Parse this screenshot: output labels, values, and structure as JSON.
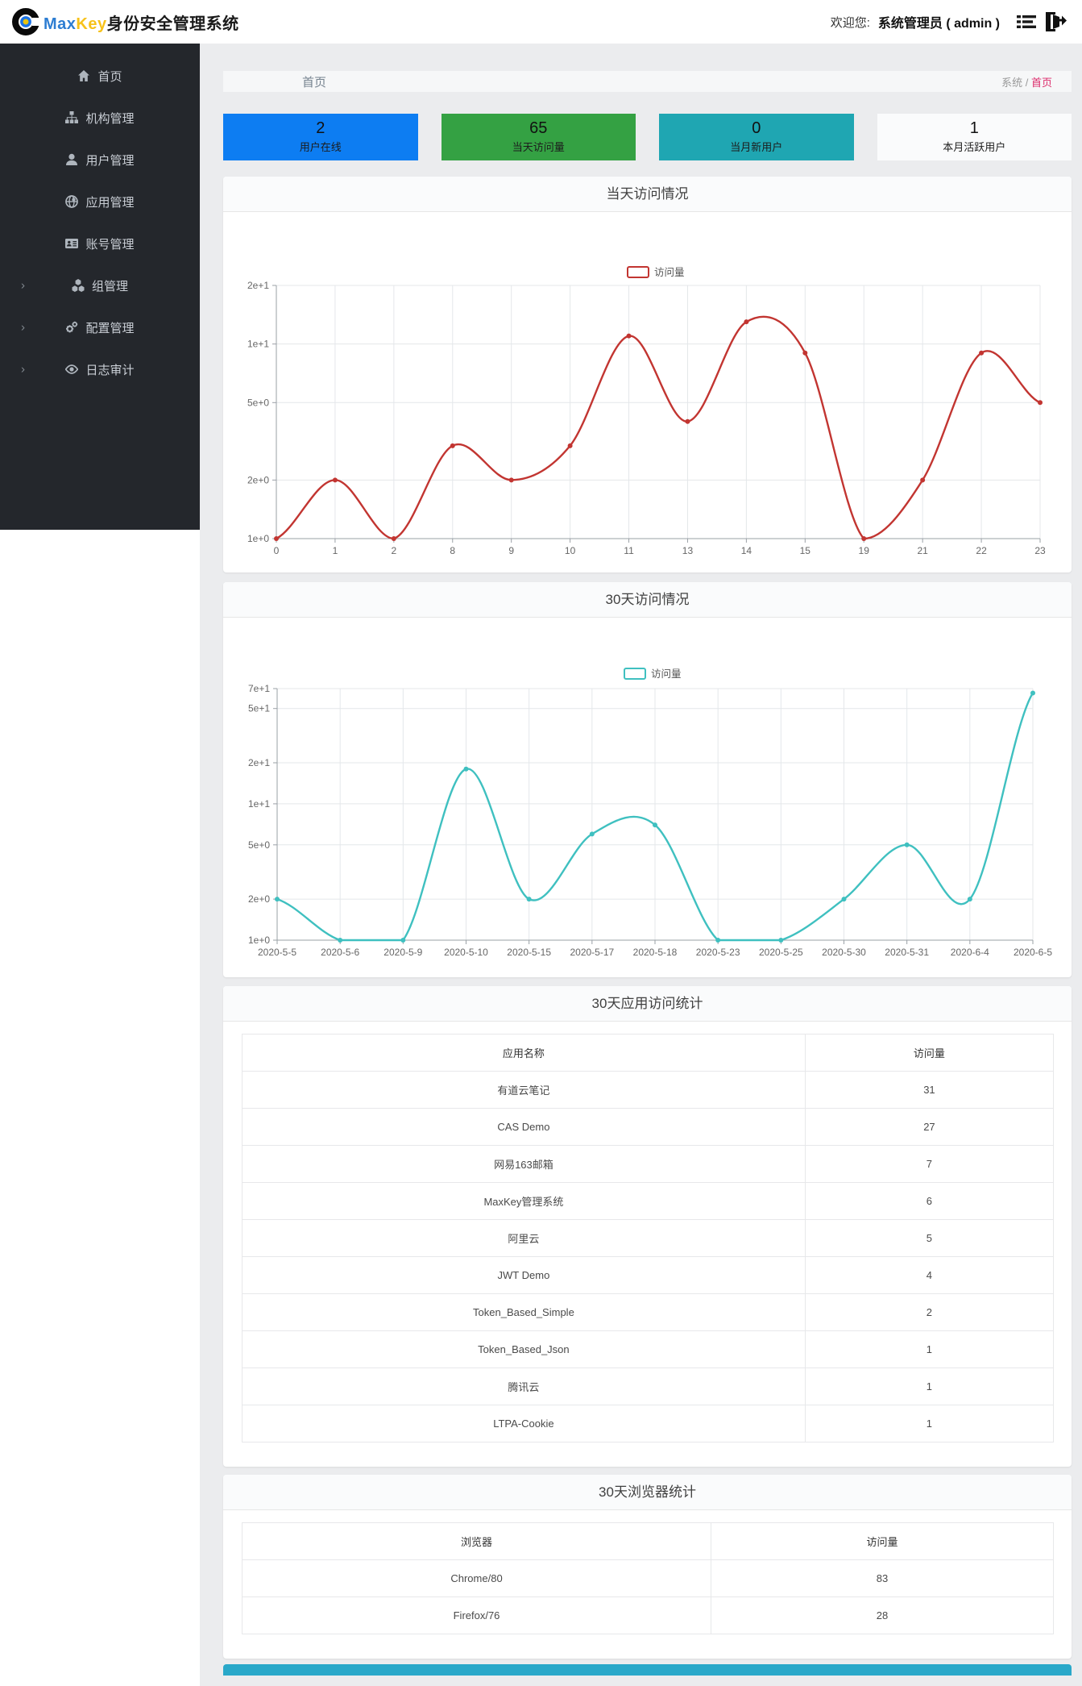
{
  "header": {
    "brand_max": "Max",
    "brand_key": "Key",
    "brand_suffix": "身份安全管理系统",
    "welcome_label": "欢迎您:",
    "admin_label": "系统管理员 ( admin )"
  },
  "sidebar": {
    "items": [
      {
        "label": "首页",
        "icon": "home-icon",
        "expandable": false
      },
      {
        "label": "机构管理",
        "icon": "org-icon",
        "expandable": false
      },
      {
        "label": "用户管理",
        "icon": "user-icon",
        "expandable": false
      },
      {
        "label": "应用管理",
        "icon": "app-icon",
        "expandable": false
      },
      {
        "label": "账号管理",
        "icon": "account-icon",
        "expandable": false
      },
      {
        "label": "组管理",
        "icon": "group-icon",
        "expandable": true
      },
      {
        "label": "配置管理",
        "icon": "config-icon",
        "expandable": true
      },
      {
        "label": "日志审计",
        "icon": "audit-icon",
        "expandable": true
      }
    ]
  },
  "breadcrumb": {
    "title": "首页",
    "crumb_root": "系统",
    "crumb_sep": " / ",
    "crumb_current": "首页"
  },
  "stat_cards": [
    {
      "value": "2",
      "label": "用户在线",
      "color": "#0d7df2"
    },
    {
      "value": "65",
      "label": "当天访问量",
      "color": "#34a143"
    },
    {
      "value": "0",
      "label": "当月新用户",
      "color": "#1fa6b2"
    },
    {
      "value": "1",
      "label": "本月活跃用户",
      "color": "#fafbfc"
    }
  ],
  "chart_data": [
    {
      "type": "line",
      "title": "当天访问情况",
      "legend": "访问量",
      "color": "#c23531",
      "smooth": true,
      "grid": true,
      "legend_position": "top-center",
      "y_scale": "log",
      "ylim": [
        1,
        20
      ],
      "y_ticks": [
        {
          "label": "1e+0",
          "value": 1
        },
        {
          "label": "2e+0",
          "value": 2
        },
        {
          "label": "5e+0",
          "value": 5
        },
        {
          "label": "1e+1",
          "value": 10
        },
        {
          "label": "2e+1",
          "value": 20
        }
      ],
      "categories": [
        "0",
        "1",
        "2",
        "8",
        "9",
        "10",
        "11",
        "13",
        "14",
        "15",
        "19",
        "21",
        "22",
        "23"
      ],
      "values": [
        1,
        2,
        1,
        3,
        2,
        3,
        11,
        4,
        13,
        9,
        1,
        2,
        9,
        5
      ]
    },
    {
      "type": "line",
      "title": "30天访问情况",
      "legend": "访问量",
      "color": "#3fc0c0",
      "smooth": true,
      "grid": true,
      "legend_position": "top-center",
      "y_scale": "log",
      "ylim": [
        1,
        70
      ],
      "y_ticks": [
        {
          "label": "1e+0",
          "value": 1
        },
        {
          "label": "2e+0",
          "value": 2
        },
        {
          "label": "5e+0",
          "value": 5
        },
        {
          "label": "1e+1",
          "value": 10
        },
        {
          "label": "2e+1",
          "value": 20
        },
        {
          "label": "5e+1",
          "value": 50
        },
        {
          "label": "7e+1",
          "value": 70
        }
      ],
      "categories": [
        "2020-5-5",
        "2020-5-6",
        "2020-5-9",
        "2020-5-10",
        "2020-5-15",
        "2020-5-17",
        "2020-5-18",
        "2020-5-23",
        "2020-5-25",
        "2020-5-30",
        "2020-5-31",
        "2020-6-4",
        "2020-6-5"
      ],
      "values": [
        2,
        1,
        1,
        18,
        2,
        6,
        7,
        1,
        1,
        2,
        5,
        2,
        65
      ]
    }
  ],
  "tables": [
    {
      "title": "30天应用访问统计",
      "headers": [
        "应用名称",
        "访问量"
      ],
      "rows": [
        [
          "有道云笔记",
          "31"
        ],
        [
          "CAS Demo",
          "27"
        ],
        [
          "网易163邮箱",
          "7"
        ],
        [
          "MaxKey管理系统",
          "6"
        ],
        [
          "阿里云",
          "5"
        ],
        [
          "JWT Demo",
          "4"
        ],
        [
          "Token_Based_Simple",
          "2"
        ],
        [
          "Token_Based_Json",
          "1"
        ],
        [
          "腾讯云",
          "1"
        ],
        [
          "LTPA-Cookie",
          "1"
        ]
      ]
    },
    {
      "title": "30天浏览器统计",
      "headers": [
        "浏览器",
        "访问量"
      ],
      "rows": [
        [
          "Chrome/80",
          "83"
        ],
        [
          "Firefox/76",
          "28"
        ]
      ]
    }
  ],
  "footer_bar": {
    "color": "#29a8c9"
  }
}
